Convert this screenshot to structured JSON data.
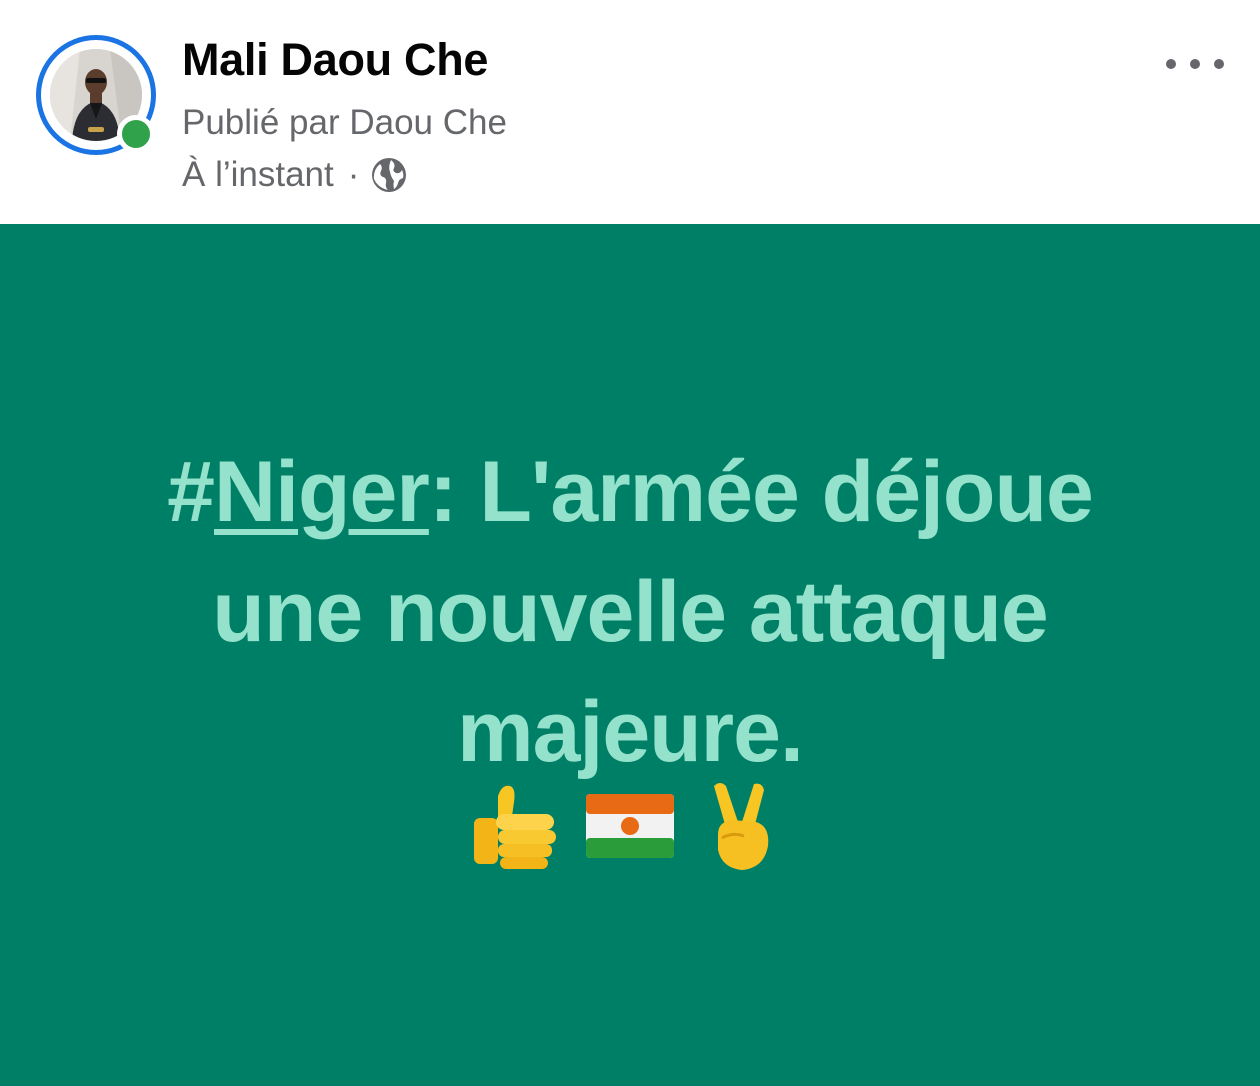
{
  "post": {
    "page_name": "Mali Daou Che",
    "published_by": "Publié par Daou Che",
    "timestamp": "À l’instant",
    "separator": "·",
    "privacy_icon": "globe-icon",
    "more_icon": "more-horizontal-icon",
    "online_status_color": "#31a24c",
    "story_ring_color": "#1b74e4"
  },
  "content": {
    "background_color": "#007f67",
    "text_color": "#94e2cb",
    "hashtag_symbol": "#",
    "hashtag": "Niger",
    "text_rest": ": L'armée déjoue une nouvelle attaque majeure.",
    "emojis": [
      "thumbs-up-icon",
      "niger-flag-icon",
      "victory-hand-icon"
    ]
  }
}
